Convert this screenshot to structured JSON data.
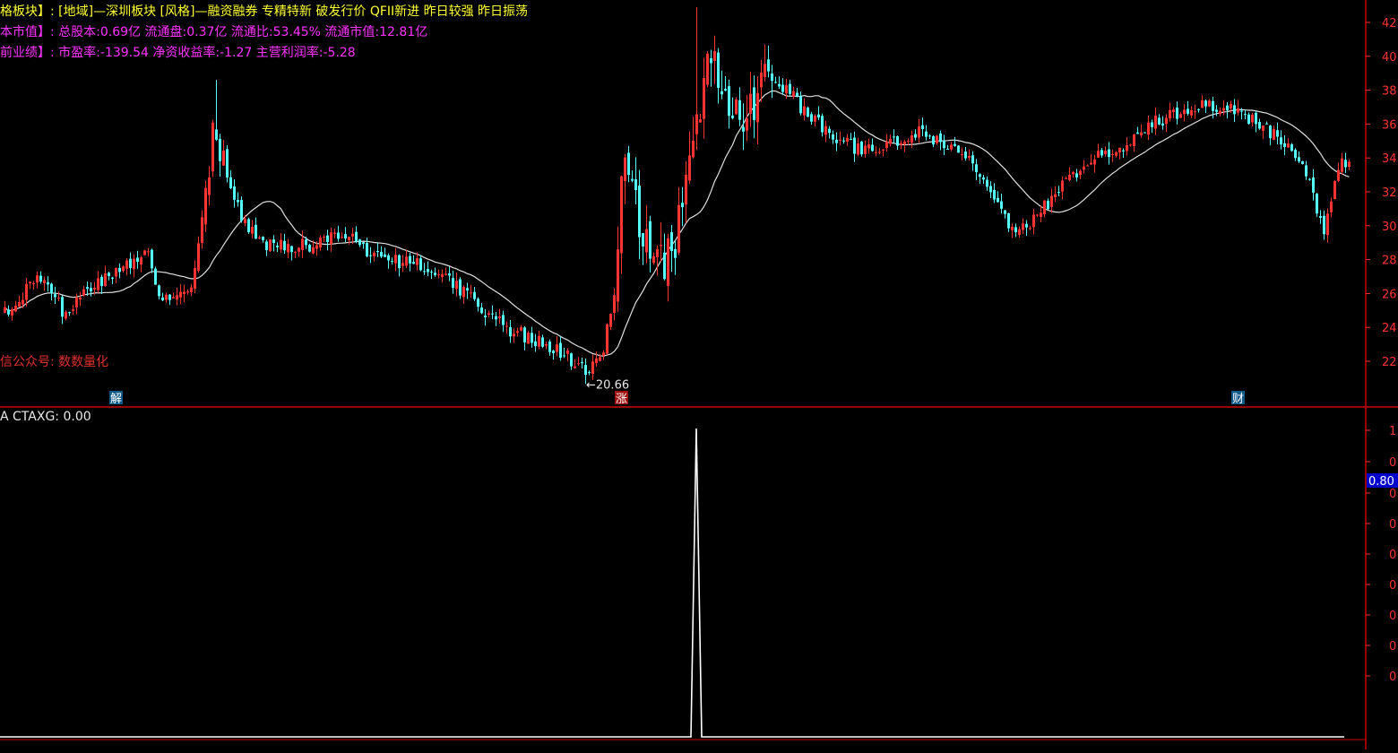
{
  "header": {
    "line1_prefix": "格板块】:",
    "line1_text": "[地域]—深圳板块 [风格]—融资融券 专精特新 破发行价 QFII新进 昨日较强 昨日振荡",
    "line2_prefix": "本市值】:",
    "line2_text": "总股本:0.69亿 流通盘:0.37亿 流通比:53.45% 流通市值:12.81亿",
    "line3_prefix": "前业绩】:",
    "line3_text": "市盈率:-139.54 净资收益率:-1.27 主营利润率:-5.28"
  },
  "watermark": "信公众号: 数数量化",
  "indicator": {
    "name": "A",
    "label": "CTAXG: 0.00",
    "current_marker": "0.80"
  },
  "colors": {
    "up": "#ff3333",
    "down": "#54fcfc",
    "ma": "#e0e0e0",
    "border": "#cc0000",
    "axis_text": "#ff3333",
    "info_yellow": "#ffff33",
    "info_magenta": "#ff33ff",
    "marker_bg": "#0000cc"
  },
  "chart_data": [
    {
      "type": "candlestick",
      "y_axis_ticks": [
        "42",
        "40",
        "38",
        "36",
        "34",
        "32",
        "30",
        "28",
        "26",
        "24",
        "22"
      ],
      "ylim": [
        20,
        43
      ],
      "low_annotation": "20.66",
      "event_badges": [
        {
          "label": "解",
          "bar_index": 31,
          "color": "#54fcfc"
        },
        {
          "label": "涨",
          "bar_index": 172,
          "color": "#ff3333"
        },
        {
          "label": "财",
          "bar_index": 344,
          "color": "#54fcfc"
        }
      ],
      "series_ma_description": "",
      "anchors": [
        [
          0,
          25
        ],
        [
          10,
          27
        ],
        [
          16,
          25
        ],
        [
          32,
          27.6
        ],
        [
          40,
          28.2
        ],
        [
          44,
          25.5
        ],
        [
          52,
          26
        ],
        [
          58,
          35
        ],
        [
          62,
          33
        ],
        [
          66,
          30.5
        ],
        [
          72,
          29
        ],
        [
          86,
          28.8
        ],
        [
          95,
          29.5
        ],
        [
          105,
          28
        ],
        [
          120,
          27.5
        ],
        [
          128,
          26
        ],
        [
          140,
          24
        ],
        [
          155,
          22.5
        ],
        [
          162,
          21.5
        ],
        [
          166,
          22
        ],
        [
          170,
          25.5
        ],
        [
          172,
          34
        ],
        [
          176,
          31
        ],
        [
          180,
          27.8
        ],
        [
          186,
          28.2
        ],
        [
          192,
          34
        ],
        [
          196,
          40.5
        ],
        [
          200,
          38
        ],
        [
          206,
          35.5
        ],
        [
          212,
          39
        ],
        [
          220,
          37.5
        ],
        [
          230,
          35.3
        ],
        [
          240,
          34.3
        ],
        [
          256,
          35.5
        ],
        [
          268,
          34.2
        ],
        [
          276,
          31.5
        ],
        [
          282,
          29.5
        ],
        [
          292,
          31.5
        ],
        [
          300,
          33.5
        ],
        [
          310,
          34.5
        ],
        [
          320,
          36
        ],
        [
          335,
          37.3
        ],
        [
          345,
          36.5
        ],
        [
          355,
          35.3
        ],
        [
          362,
          34
        ],
        [
          368,
          29.5
        ],
        [
          372,
          33.5
        ],
        [
          375,
          34
        ]
      ]
    },
    {
      "type": "line",
      "name": "CTAXG",
      "ylim": [
        0,
        1
      ],
      "y_axis_ticks": [
        "1",
        "0",
        "0",
        "0",
        "0",
        "0",
        "0",
        "0",
        "0"
      ],
      "pulses": [
        {
          "bar_index": 193,
          "value": 1
        }
      ]
    }
  ]
}
